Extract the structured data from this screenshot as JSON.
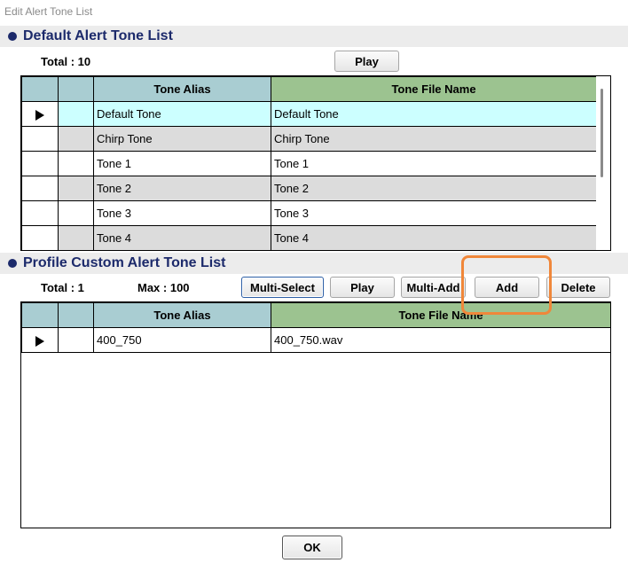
{
  "window": {
    "title": "Edit Alert Tone List"
  },
  "default_section": {
    "title": "Default Alert Tone List",
    "total": "Total : 10",
    "play_label": "Play",
    "columns": {
      "alias": "Tone Alias",
      "file": "Tone File Name"
    },
    "rows": [
      {
        "alias": "Default Tone",
        "file": "Default Tone"
      },
      {
        "alias": "Chirp Tone",
        "file": "Chirp Tone"
      },
      {
        "alias": "Tone 1",
        "file": "Tone 1"
      },
      {
        "alias": "Tone 2",
        "file": "Tone 2"
      },
      {
        "alias": "Tone 3",
        "file": "Tone 3"
      },
      {
        "alias": "Tone 4",
        "file": "Tone 4"
      }
    ]
  },
  "custom_section": {
    "title": "Profile Custom Alert Tone List",
    "total": "Total : 1",
    "max": "Max : 100",
    "buttons": {
      "multi_select": "Multi-Select",
      "play": "Play",
      "multi_add": "Multi-Add",
      "add": "Add",
      "delete": "Delete"
    },
    "columns": {
      "alias": "Tone Alias",
      "file": "Tone File Name"
    },
    "rows": [
      {
        "alias": "400_750",
        "file": "400_750.wav"
      }
    ]
  },
  "footer": {
    "ok_label": "OK"
  },
  "colors": {
    "section_title": "#1c2a6b",
    "header_alias": "#a9cdd2",
    "header_file": "#9cc390",
    "selected_row": "#ccffff",
    "alt_row": "#dcdcdc",
    "highlight": "#f0873a"
  },
  "icons": {
    "row_indicator": "triangle-right-icon",
    "section_bullet": "bullet-icon"
  }
}
